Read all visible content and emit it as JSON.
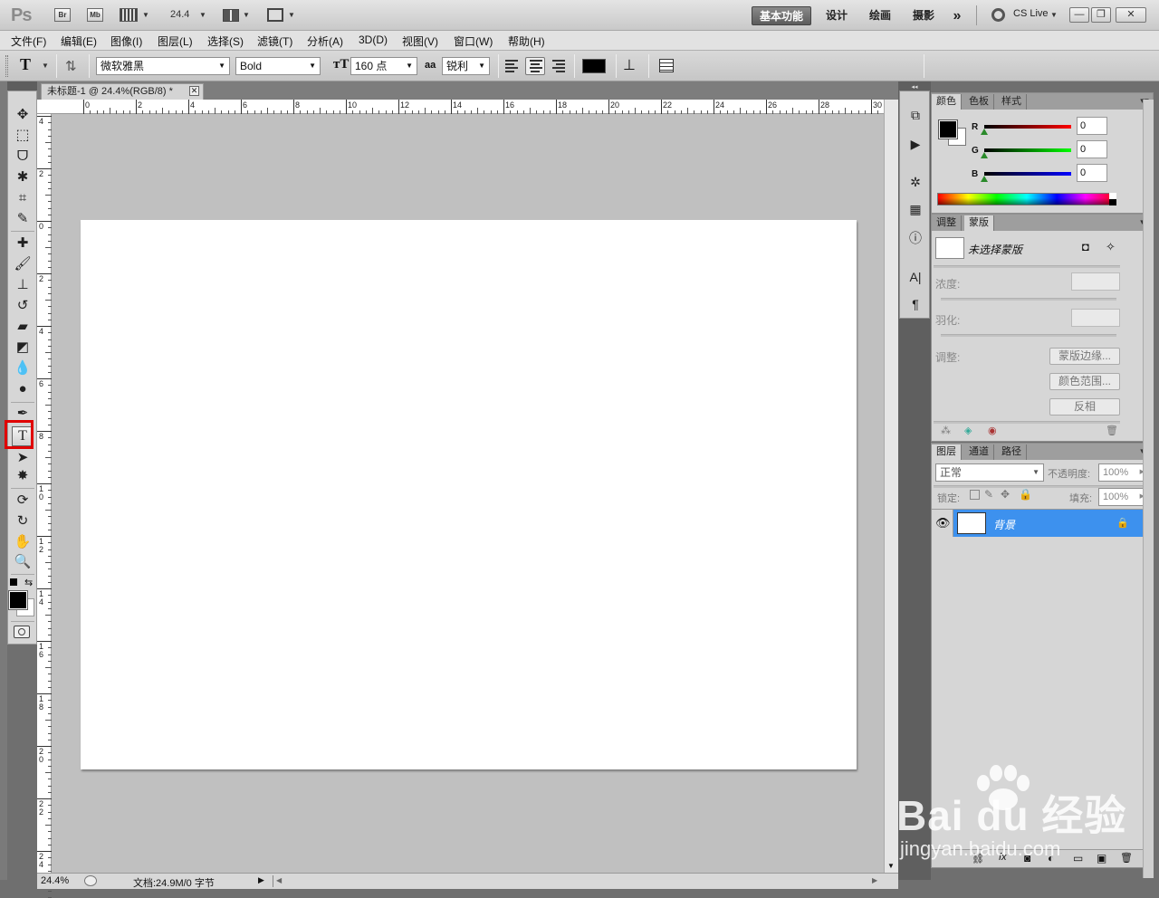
{
  "app": {
    "logo": "Ps",
    "bridge": "Br",
    "mini_bridge": "Mb",
    "zoom": "24.4",
    "workspaces": [
      "基本功能",
      "设计",
      "绘画",
      "摄影"
    ],
    "more": "»",
    "cs_live": "CS Live",
    "window_buttons": [
      "—",
      "❐",
      "✕"
    ]
  },
  "menu": [
    "文件(F)",
    "编辑(E)",
    "图像(I)",
    "图层(L)",
    "选择(S)",
    "滤镜(T)",
    "分析(A)",
    "3D(D)",
    "视图(V)",
    "窗口(W)",
    "帮助(H)"
  ],
  "options": {
    "tool_glyph": "T",
    "font_family": "微软雅黑",
    "font_style": "Bold",
    "font_size": "160 点",
    "aa_label": "aa",
    "antialias": "锐利",
    "text_color": "#000000"
  },
  "document": {
    "tab_title": "未标题-1 @ 24.4%(RGB/8) *",
    "close": "✕",
    "h_ruler": [
      "0",
      "2",
      "4",
      "6",
      "8",
      "10",
      "12",
      "14",
      "16",
      "18",
      "20",
      "22",
      "24",
      "26",
      "28",
      "30"
    ],
    "v_ruler": [
      "4",
      "2",
      "0",
      "2",
      "4",
      "6",
      "8",
      "1 0",
      "1 2",
      "1 4",
      "1 6",
      "1 8",
      "2 0",
      "2 2",
      "2 4"
    ],
    "zoom_status": "24.4%",
    "doc_info": "文档:24.9M/0 字节"
  },
  "color_panel": {
    "tabs": [
      "颜色",
      "色板",
      "样式"
    ],
    "channels": [
      {
        "label": "R",
        "value": "0"
      },
      {
        "label": "G",
        "value": "0"
      },
      {
        "label": "B",
        "value": "0"
      }
    ]
  },
  "masks_panel": {
    "tabs": [
      "调整",
      "蒙版"
    ],
    "no_mask": "未选择蒙版",
    "density": "浓度:",
    "feather": "羽化:",
    "refine": "调整:",
    "buttons": [
      "蒙版边缘...",
      "颜色范围...",
      "反相"
    ]
  },
  "layers_panel": {
    "tabs": [
      "图层",
      "通道",
      "路径"
    ],
    "blend_mode": "正常",
    "opacity_label": "不透明度:",
    "opacity": "100%",
    "lock_label": "锁定:",
    "fill_label": "填充:",
    "fill": "100%",
    "layer_name": "背景",
    "footer_icons": [
      "⛓",
      "fx",
      "◙",
      "◐",
      "▭",
      "▣",
      "🗑"
    ]
  },
  "watermark": {
    "word": "Bai du 经验",
    "url": "jingyan.baidu.com"
  },
  "colors": {
    "highlight": "#e00000",
    "accent": "#3d91ee",
    "canvas": "#ffffff",
    "pasteboard": "#c0c0c0"
  }
}
